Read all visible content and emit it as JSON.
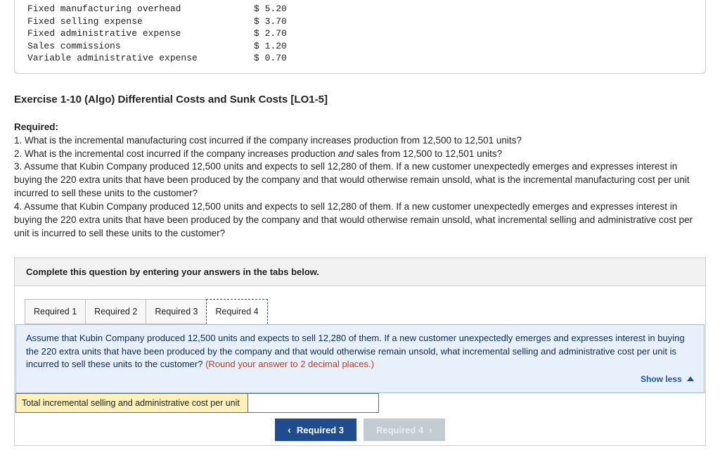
{
  "costs": [
    {
      "label": "Fixed manufacturing overhead",
      "value": "$ 5.20"
    },
    {
      "label": "Fixed selling expense",
      "value": "$ 3.70"
    },
    {
      "label": "Fixed administrative expense",
      "value": "$ 2.70"
    },
    {
      "label": "Sales commissions",
      "value": "$ 1.20"
    },
    {
      "label": "Variable administrative expense",
      "value": "$ 0.70"
    }
  ],
  "exercise_title": "Exercise 1-10 (Algo) Differential Costs and Sunk Costs [LO1-5]",
  "required_heading": "Required:",
  "required_items": [
    "1. What is the incremental manufacturing cost incurred if the company increases production from 12,500 to 12,501 units?",
    "2. What is the incremental cost incurred if the company increases production <em>and</em> sales from 12,500 to 12,501 units?",
    "3. Assume that Kubin Company produced 12,500 units and expects to sell 12,280 of them. If a new customer unexpectedly emerges and expresses interest in buying the 220 extra units that have been produced by the company and that would otherwise remain unsold, what is the incremental manufacturing cost per unit incurred to sell these units to the customer?",
    "4. Assume that Kubin Company produced 12,500 units and expects to sell 12,280 of them. If a new customer unexpectedly emerges and expresses interest in buying the 220 extra units that have been produced by the company and that would otherwise remain unsold, what incremental selling and administrative cost per unit is incurred to sell these units to the customer?"
  ],
  "complete_bar": "Complete this question by entering your answers in the tabs below.",
  "tabs": {
    "items": [
      "Required 1",
      "Required 2",
      "Required 3",
      "Required 4"
    ],
    "active_index": 3
  },
  "prompt": {
    "main": "Assume that Kubin Company produced 12,500 units and expects to sell 12,280 of them. If a new customer unexpectedly emerges and expresses interest in buying the 220 extra units that have been produced by the company and that would otherwise remain unsold, what incremental selling and administrative cost per unit is incurred to sell these units to the customer? ",
    "rounding": "(Round your answer to 2 decimal places.)",
    "show_less": "Show less"
  },
  "answer_row": {
    "label": "Total incremental selling and administrative cost per unit",
    "value": ""
  },
  "nav": {
    "prev": "Required 3",
    "next": "Required 4"
  }
}
